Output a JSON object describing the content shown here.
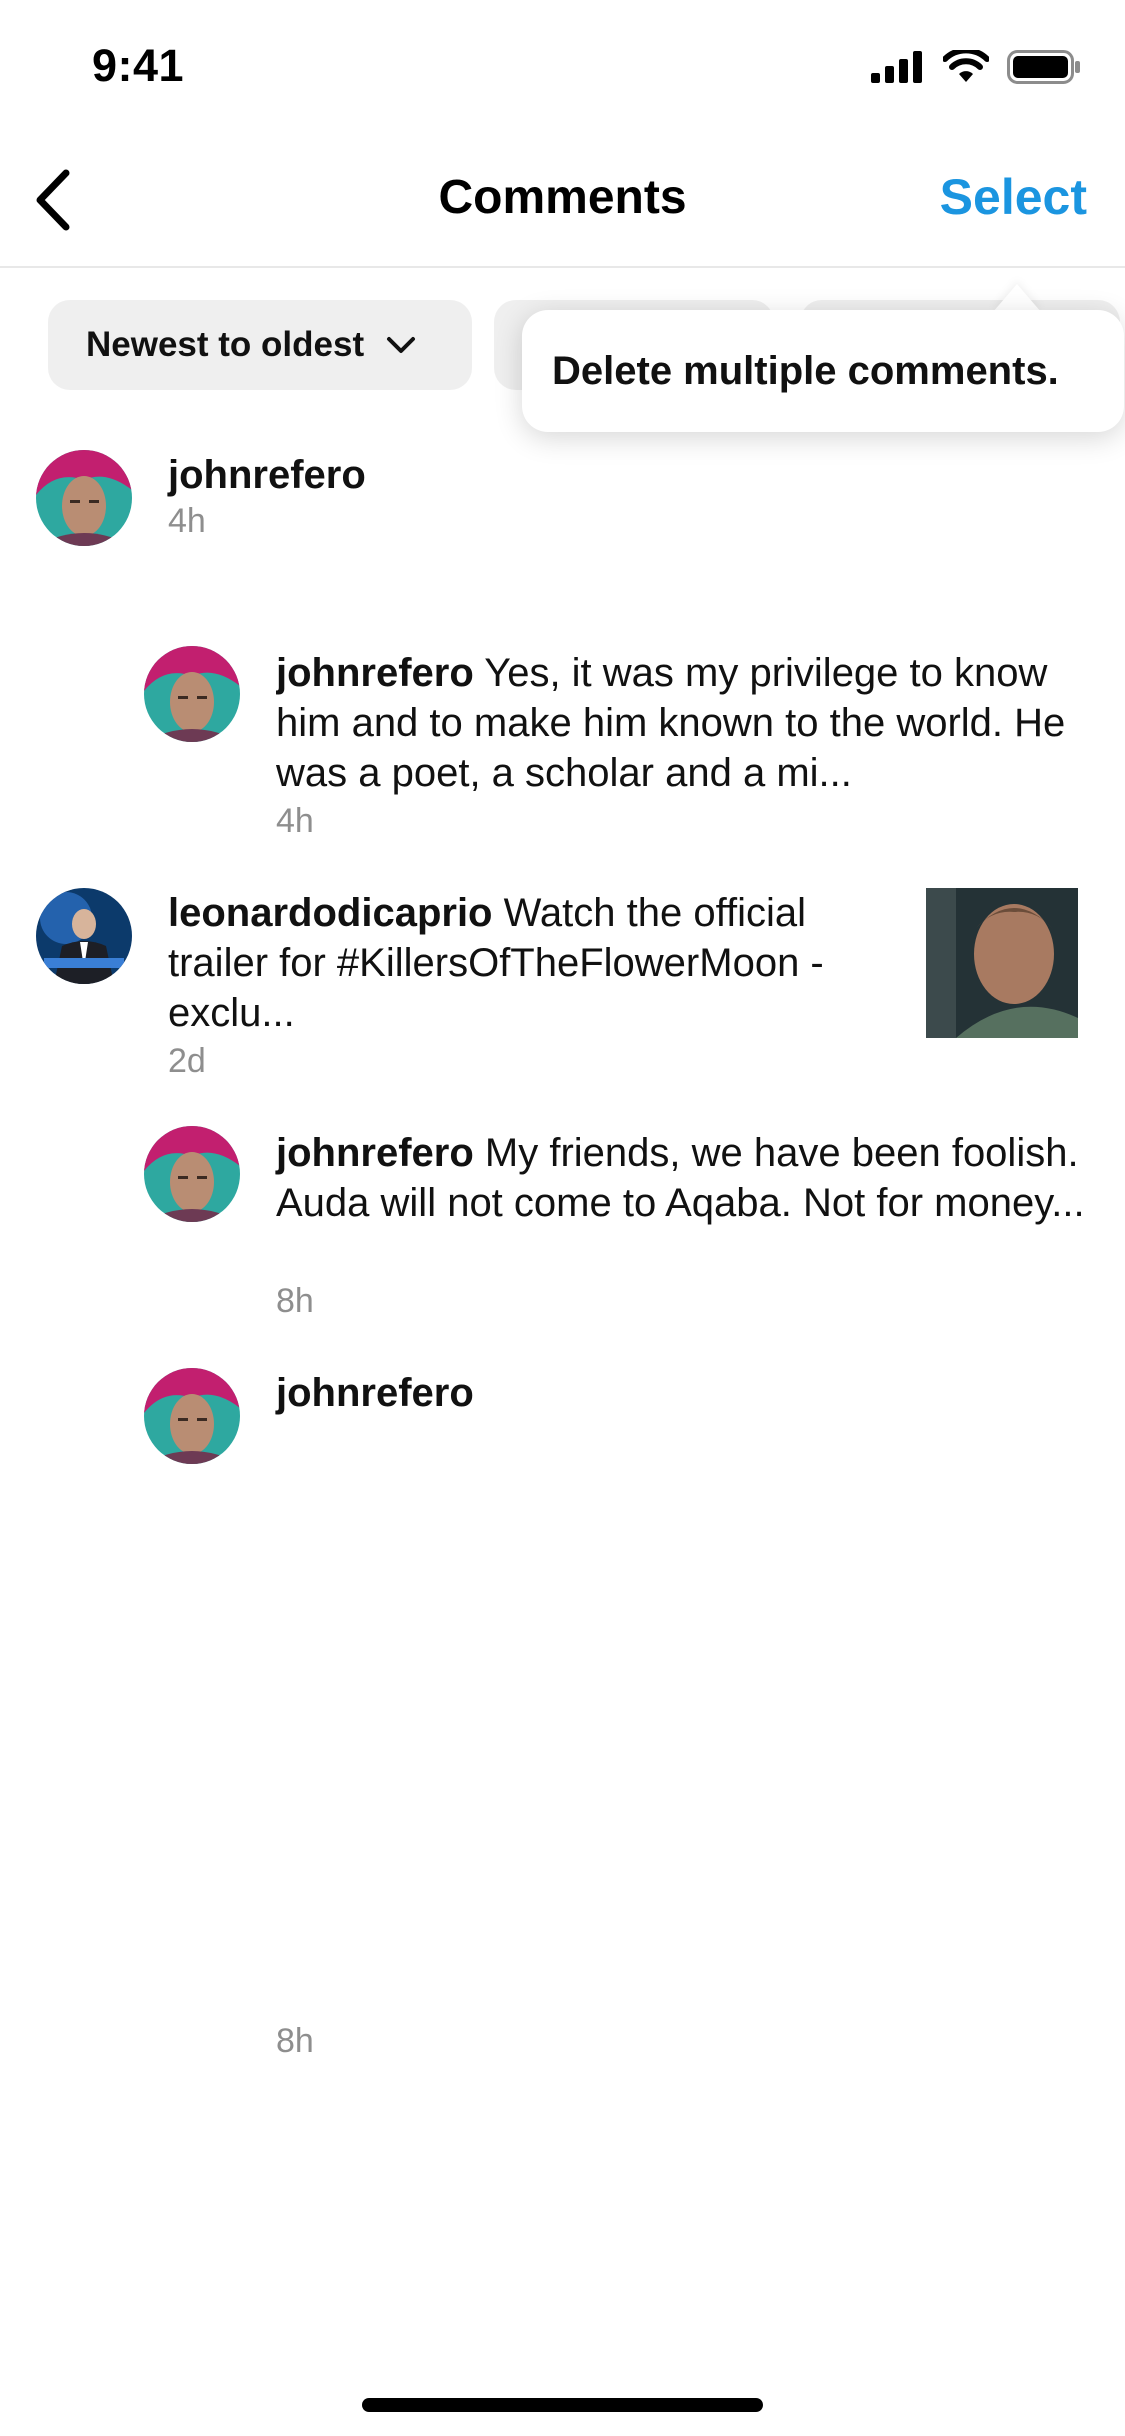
{
  "status_bar": {
    "time": "9:41"
  },
  "header": {
    "back_icon": "chevron-left-icon",
    "title": "Comments",
    "select_label": "Select"
  },
  "filters": {
    "sort_label": "Newest to oldest",
    "sort_icon": "chevron-down-icon"
  },
  "tooltip": {
    "text": "Delete multiple comments."
  },
  "comments": [
    {
      "username": "johnrefero",
      "text": "",
      "time": "4h"
    },
    {
      "username": "johnrefero",
      "text": " Yes, it was my privilege to know him and to make him known to the world. He was a poet, a scholar and a mi...",
      "time": "4h"
    },
    {
      "username": "leonardodicaprio",
      "text": " Watch the official trailer for #KillersOfTheFlowerMoon - exclu...",
      "time": "2d"
    },
    {
      "username": "johnrefero",
      "text": " My friends, we have been foolish. Auda will not come to Aqaba. Not for money...",
      "time": "8h"
    },
    {
      "username": "johnrefero",
      "text": "",
      "time": "8h"
    }
  ],
  "colors": {
    "accent": "#1b95e0",
    "chip_bg": "#efefef",
    "muted": "#8e8e8e"
  }
}
